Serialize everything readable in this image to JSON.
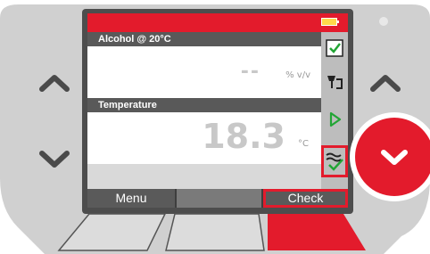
{
  "screen": {
    "alcohol": {
      "label": "Alcohol @ 20°C",
      "value": "-- ",
      "unit": "% v/v"
    },
    "temperature": {
      "label": "Temperature",
      "value": "18.3",
      "unit": "°C"
    }
  },
  "softkeys": {
    "left": "Menu",
    "middle": "",
    "right": "Check"
  },
  "side_icons": [
    "checkbox-icon",
    "sample-icon",
    "play-icon",
    "adjust-icon"
  ],
  "colors": {
    "brand_red": "#e31b2c",
    "check_green": "#22a535",
    "battery": "#ffd94a"
  }
}
